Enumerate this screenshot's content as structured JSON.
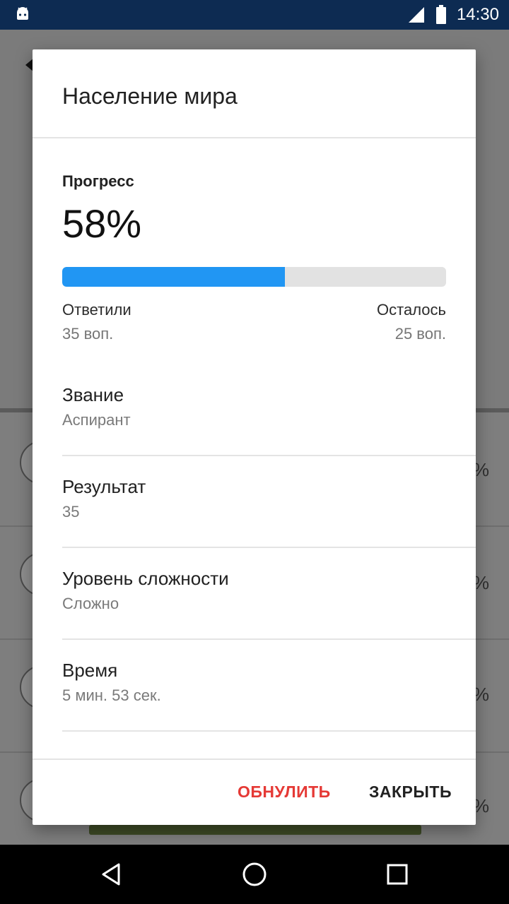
{
  "status_bar": {
    "time": "14:30",
    "icons": [
      "android-icon",
      "signal-icon",
      "battery-icon"
    ]
  },
  "background": {
    "percent_marks": [
      "%",
      "%",
      "%",
      "%"
    ],
    "accent_green": "#3d4a25"
  },
  "dialog": {
    "title": "Население мира",
    "progress": {
      "label": "Прогресс",
      "value_text": "58%",
      "fraction": 0.58,
      "bar_color": "#2196f3"
    },
    "answered": {
      "label": "Ответили",
      "value": "35 воп."
    },
    "remaining": {
      "label": "Осталось",
      "value": "25 воп."
    },
    "items": [
      {
        "title": "Звание",
        "value": "Аспирант"
      },
      {
        "title": "Результат",
        "value": "35"
      },
      {
        "title": "Уровень сложности",
        "value": "Сложно"
      },
      {
        "title": "Время",
        "value": "5 мин. 53 сек."
      }
    ],
    "buttons": {
      "reset": "ОБНУЛИТЬ",
      "close": "ЗАКРЫТЬ",
      "reset_color": "#e53935"
    }
  },
  "nav_bar": {
    "icons": [
      "back-icon",
      "home-icon",
      "recents-icon"
    ]
  }
}
